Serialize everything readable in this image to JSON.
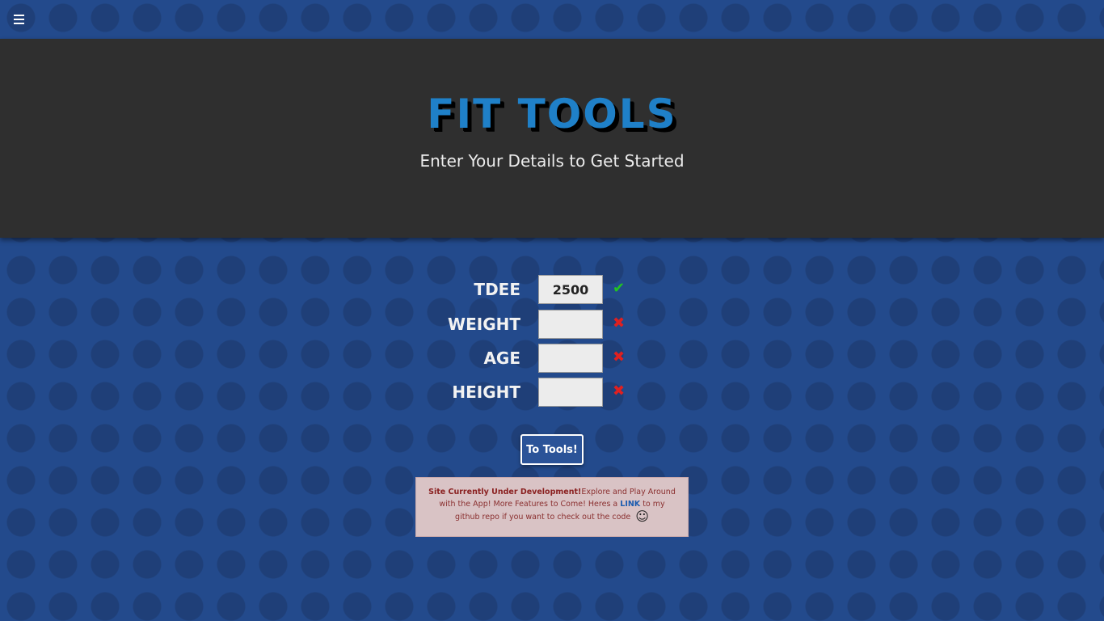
{
  "nav": {
    "menu_icon": "hamburger-menu-icon"
  },
  "header": {
    "title": "FIT TOOLS",
    "subtitle": "Enter Your Details to Get Started"
  },
  "form": {
    "fields": [
      {
        "label": "TDEE",
        "value": "2500",
        "status": "valid",
        "status_icon": "check-icon"
      },
      {
        "label": "WEIGHT",
        "value": "",
        "status": "invalid",
        "status_icon": "x-icon"
      },
      {
        "label": "AGE",
        "value": "",
        "status": "invalid",
        "status_icon": "x-icon"
      },
      {
        "label": "HEIGHT",
        "value": "",
        "status": "invalid",
        "status_icon": "x-icon"
      }
    ],
    "submit_label": "To Tools!"
  },
  "notice": {
    "bold_text": "Site Currently Under Development!",
    "text_before_link": "Explore and Play Around with the App! More Features to Come! Heres a ",
    "link_text": "LINK",
    "text_after_link": " to my github repo if you want to check out the code",
    "smiley_icon": "smiley-icon"
  },
  "colors": {
    "background": "#234a8c",
    "header_bg": "#2f2f2f",
    "title": "#1f80c8",
    "valid": "#22c322",
    "invalid": "#e02020",
    "notice_bg": "#d9c3c5"
  }
}
